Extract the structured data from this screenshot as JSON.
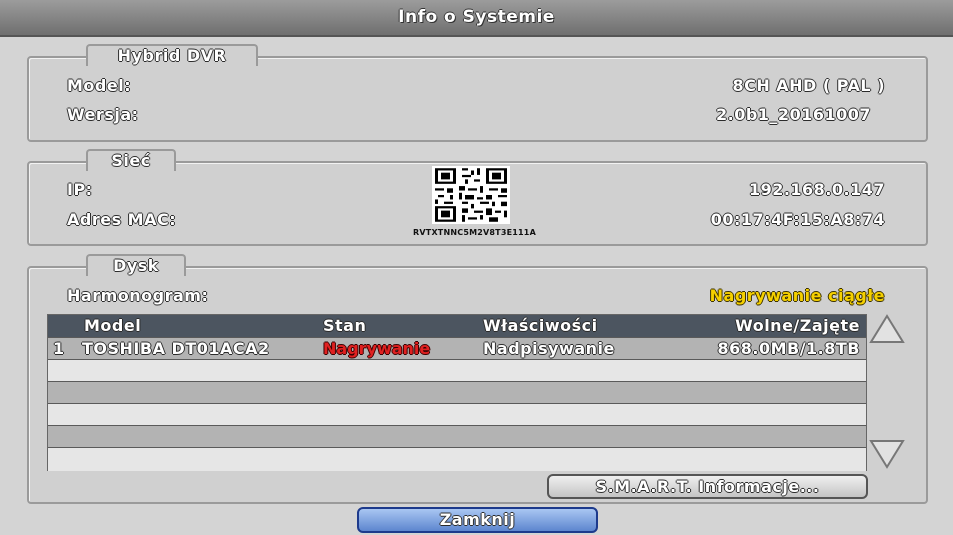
{
  "window": {
    "title": "Info o Systemie"
  },
  "hybrid": {
    "title": "Hybrid DVR",
    "model_label": "Model:",
    "model_value": "8CH AHD ( PAL )",
    "version_label": "Wersja:",
    "version_value": "2.0b1_20161007"
  },
  "network": {
    "title": "Sieć",
    "ip_label": "IP:",
    "ip_value": "192.168.0.147",
    "mac_label": "Adres MAC:",
    "mac_value": "00:17:4F:15:A8:74",
    "qr_caption": "RVTXTNNC5M2V8T3E111A"
  },
  "disk": {
    "title": "Dysk",
    "schedule_label": "Harmonogram:",
    "schedule_value": "Nagrywanie ciągłe",
    "columns": [
      "Model",
      "Stan",
      "Właściwości",
      "Wolne/Zajęte"
    ],
    "rows": [
      {
        "index": "1",
        "model": "TOSHIBA DT01ACA2",
        "state": "Nagrywanie",
        "property": "Nadpisywanie",
        "space": "868.0MB/1.8TB"
      }
    ],
    "smart_button": "S.M.A.R.T. Informacje..."
  },
  "footer": {
    "close_button": "Zamknij"
  },
  "colors": {
    "accent_red": "#e02020",
    "accent_yellow": "#f5d000",
    "header_bg": "#4c5560"
  }
}
